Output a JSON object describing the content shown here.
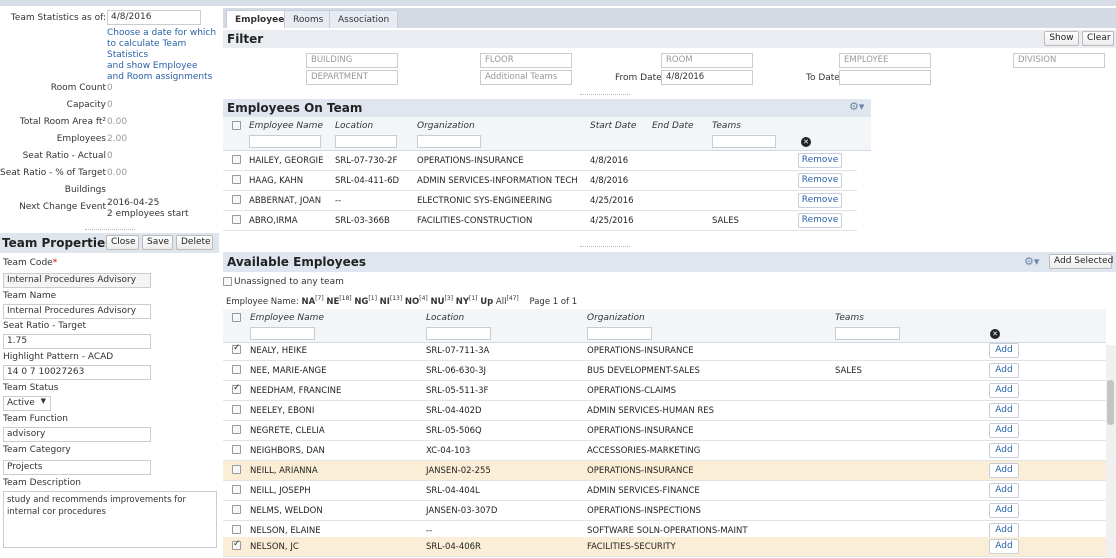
{
  "left": {
    "stats_label": "Team Statistics as of:",
    "stats_date": "4/8/2016",
    "date_hint": [
      "Choose a date for which",
      "to calculate Team Statistics",
      "and show Employee",
      "and Room assignments"
    ],
    "stats": [
      {
        "label": "Room Count",
        "value": "0"
      },
      {
        "label": "Capacity",
        "value": "0"
      },
      {
        "label": "Total Room Area ft²",
        "value": "0.00"
      },
      {
        "label": "Employees",
        "value": "2.00"
      },
      {
        "label": "Seat Ratio - Actual",
        "value": "0"
      },
      {
        "label": "Seat Ratio - % of Target",
        "value": "0.00"
      },
      {
        "label": "Buildings",
        "value": ""
      },
      {
        "label": "Next Change Event",
        "value": "2016-04-25"
      }
    ],
    "next_change_note": "2 employees start",
    "team_properties": {
      "title": "Team Properties",
      "close": "Close",
      "save": "Save",
      "delete": "Delete",
      "team_code_label": "Team Code",
      "required_mark": "*",
      "team_code": "Internal Procedures Advisory",
      "team_name_label": "Team Name",
      "team_name": "Internal Procedures Advisory",
      "seat_ratio_label": "Seat Ratio - Target",
      "seat_ratio": "1.75",
      "highlight_label": "Highlight Pattern - ACAD",
      "highlight": "14 0 7 10027263",
      "status_label": "Team Status",
      "status": "Active",
      "function_label": "Team Function",
      "function": "advisory",
      "category_label": "Team Category",
      "category": "Projects",
      "description_label": "Team Description",
      "description": "study and recommends improvements for internal cor procedures"
    }
  },
  "tabs": [
    "Employees",
    "Rooms",
    "Association"
  ],
  "filter": {
    "title": "Filter",
    "show": "Show",
    "clear": "Clear",
    "building": "BUILDING",
    "floor": "FLOOR",
    "room": "ROOM",
    "employee": "EMPLOYEE",
    "division": "DIVISION",
    "department": "DEPARTMENT",
    "additional_teams": "Additional Teams",
    "from_date_label": "From Date",
    "from_date": "4/8/2016",
    "to_date_label": "To Date",
    "to_date": ""
  },
  "on_team": {
    "title": "Employees On Team",
    "columns": [
      "Employee Name",
      "Location",
      "Organization",
      "Start Date",
      "End Date",
      "Teams"
    ],
    "remove_label": "Remove",
    "rows": [
      {
        "name": "HAILEY, GEORGIE",
        "location": "SRL-07-730-2F",
        "org": "OPERATIONS-INSURANCE",
        "start": "4/8/2016",
        "end": "",
        "teams": ""
      },
      {
        "name": "HAAG, KAHN",
        "location": "SRL-04-411-6D",
        "org": "ADMIN SERVICES-INFORMATION TECH",
        "start": "4/8/2016",
        "end": "",
        "teams": ""
      },
      {
        "name": "ABBERNAT, JOAN",
        "location": "--",
        "org": "ELECTRONIC SYS-ENGINEERING",
        "start": "4/25/2016",
        "end": "",
        "teams": ""
      },
      {
        "name": "ABRO,IRMA",
        "location": "SRL-03-366B",
        "org": "FACILITIES-CONSTRUCTION",
        "start": "4/25/2016",
        "end": "",
        "teams": "SALES"
      }
    ]
  },
  "available": {
    "title": "Available Employees",
    "add_selected": "Add Selected",
    "unassigned_label": "Unassigned to any team",
    "index_label": "Employee Name:",
    "index": [
      {
        "k": "NA",
        "n": "[7]"
      },
      {
        "k": "NE",
        "n": "[18]"
      },
      {
        "k": "NG",
        "n": "[1]"
      },
      {
        "k": "NI",
        "n": "[13]"
      },
      {
        "k": "NO",
        "n": "[4]"
      },
      {
        "k": "NU",
        "n": "[3]"
      },
      {
        "k": "NY",
        "n": "[1]"
      },
      {
        "k": "Up",
        "n": ""
      },
      {
        "k": "All",
        "n": "[47]"
      }
    ],
    "page": "Page 1 of 1",
    "columns": [
      "Employee Name",
      "Location",
      "Organization",
      "Teams"
    ],
    "add_label": "Add",
    "rows": [
      {
        "name": "NEALY, HEIKE",
        "location": "SRL-07-711-3A",
        "org": "OPERATIONS-INSURANCE",
        "teams": "",
        "checked": true,
        "hl": false
      },
      {
        "name": "NEE, MARIE-ANGE",
        "location": "SRL-06-630-3J",
        "org": "BUS DEVELOPMENT-SALES",
        "teams": "SALES",
        "checked": false,
        "hl": false
      },
      {
        "name": "NEEDHAM, FRANCINE",
        "location": "SRL-05-511-3F",
        "org": "OPERATIONS-CLAIMS",
        "teams": "",
        "checked": true,
        "hl": false
      },
      {
        "name": "NEELEY, EBONI",
        "location": "SRL-04-402D",
        "org": "ADMIN SERVICES-HUMAN RES",
        "teams": "",
        "checked": false,
        "hl": false
      },
      {
        "name": "NEGRETE, CLELIA",
        "location": "SRL-05-506Q",
        "org": "OPERATIONS-INSURANCE",
        "teams": "",
        "checked": false,
        "hl": false
      },
      {
        "name": "NEIGHBORS, DAN",
        "location": "XC-04-103",
        "org": "ACCESSORIES-MARKETING",
        "teams": "",
        "checked": false,
        "hl": false
      },
      {
        "name": "NEILL, ARIANNA",
        "location": "JANSEN-02-255",
        "org": "OPERATIONS-INSURANCE",
        "teams": "",
        "checked": false,
        "hl": true
      },
      {
        "name": "NEILL, JOSEPH",
        "location": "SRL-04-404L",
        "org": "ADMIN SERVICES-FINANCE",
        "teams": "",
        "checked": false,
        "hl": false
      },
      {
        "name": "NELMS, WELDON",
        "location": "JANSEN-03-307D",
        "org": "OPERATIONS-INSPECTIONS",
        "teams": "",
        "checked": false,
        "hl": false
      },
      {
        "name": "NELSON, ELAINE",
        "location": "--",
        "org": "SOFTWARE SOLN-OPERATIONS-MAINT",
        "teams": "",
        "checked": false,
        "hl": false
      },
      {
        "name": "NELSON, JC",
        "location": "SRL-04-406R",
        "org": "FACILITIES-SECURITY",
        "teams": "",
        "checked": true,
        "hl": true
      }
    ]
  },
  "icons": {
    "gear": "gear-icon",
    "clear": "clear-filter-icon",
    "dropdown": "chevron-down-icon"
  }
}
